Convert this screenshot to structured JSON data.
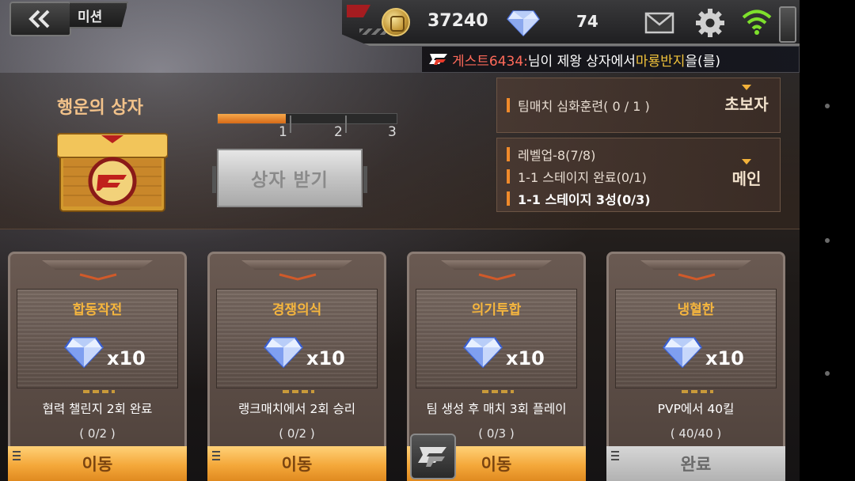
{
  "header": {
    "back_icon": "double-chevron-left-icon",
    "title": "미션"
  },
  "resources": {
    "coin_icon": "gold-coin-icon",
    "coins": "37240",
    "gem_icon": "diamond-icon",
    "gems": "74",
    "mail_icon": "mail-icon",
    "settings_icon": "gear-icon",
    "wifi_icon": "wifi-icon"
  },
  "ticker": {
    "logo": "CF",
    "player": "게스트6434:",
    "text_before": "님이 제왕 상자에서 ",
    "item": "마룡반지",
    "text_after": "을(를)"
  },
  "lucky_box": {
    "title": "행운의 상자",
    "progress_fraction": 0.38,
    "steps": [
      "1",
      "2",
      "3"
    ],
    "claim_label": "상자 받기",
    "chest_logo": "CF"
  },
  "quests": {
    "beginner": {
      "lines": [
        "팀매치 심화훈련( 0 / 1 )"
      ],
      "tag": "초보자"
    },
    "main": {
      "lines": [
        "레벨업-8(7/8)",
        "1-1 스테이지 완료(0/1)",
        "1-1 스테이지 3성(0/3)"
      ],
      "tag": "메인"
    }
  },
  "missions": [
    {
      "title": "합동작전",
      "reward": "x10",
      "desc": "협력 챌린지 2회 완료",
      "progress": "( 0/2 )",
      "action": "이동",
      "state": "go"
    },
    {
      "title": "경쟁의식",
      "reward": "x10",
      "desc": "랭크매치에서 2회 승리",
      "progress": "( 0/2 )",
      "action": "이동",
      "state": "go"
    },
    {
      "title": "의기투합",
      "reward": "x10",
      "desc": "팀 생성 후 매치 3회 플레이",
      "progress": "( 0/3 )",
      "action": "이동",
      "state": "go"
    },
    {
      "title": "냉혈한",
      "reward": "x10",
      "desc": "PVP에서 40킬",
      "progress": "( 40/40 )",
      "action": "완료",
      "state": "done"
    }
  ],
  "colors": {
    "accent_orange": "#f4a83a",
    "title_gold": "#f6b63e",
    "ticker_player": "#ff6a5a",
    "ticker_item": "#f1c23a"
  }
}
